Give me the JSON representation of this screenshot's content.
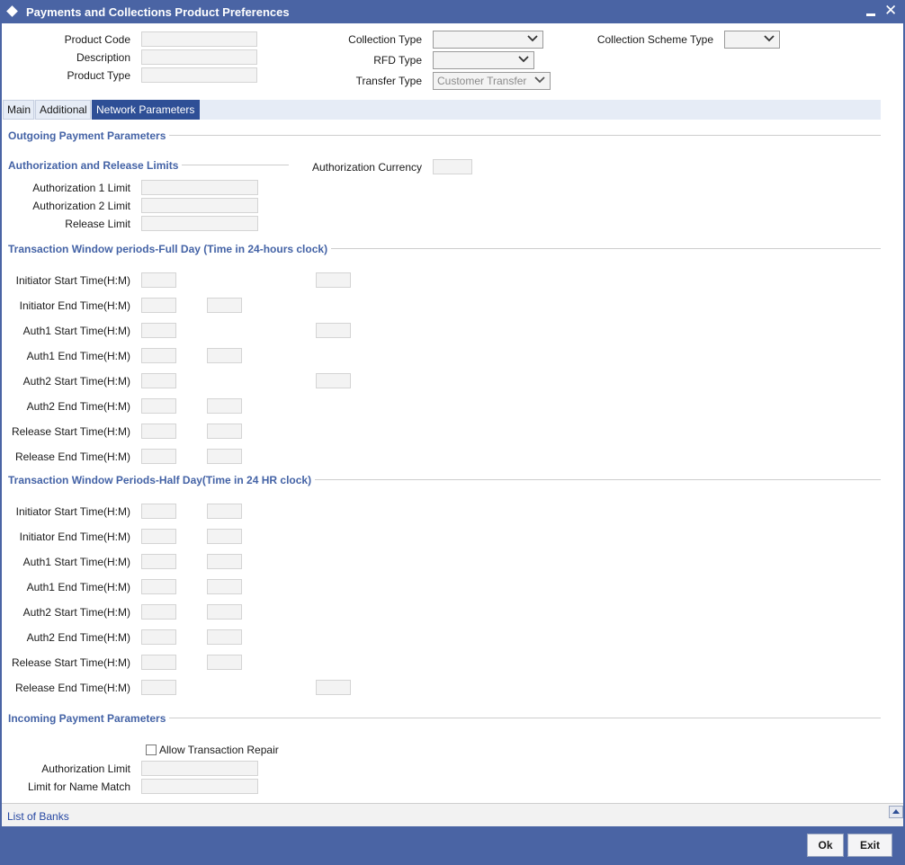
{
  "window": {
    "title": "Payments and Collections Product Preferences"
  },
  "header": {
    "product_code_label": "Product Code",
    "description_label": "Description",
    "product_type_label": "Product Type",
    "collection_type_label": "Collection Type",
    "rfd_type_label": "RFD Type",
    "transfer_type_label": "Transfer Type",
    "transfer_type_value": "Customer Transfer",
    "collection_scheme_type_label": "Collection Scheme Type"
  },
  "tabs": [
    {
      "label": "Main"
    },
    {
      "label": "Additional"
    },
    {
      "label": "Network Parameters"
    }
  ],
  "outgoing": {
    "title": "Outgoing Payment Parameters",
    "auth_limits_title": "Authorization and Release Limits",
    "auth_currency_label": "Authorization Currency",
    "auth1_limit_label": "Authorization 1 Limit",
    "auth2_limit_label": "Authorization 2 Limit",
    "release_limit_label": "Release Limit"
  },
  "full_day": {
    "title": "Transaction Window periods-Full Day (Time in 24-hours clock)",
    "rows": [
      "Initiator Start Time(H:M)",
      "Initiator End Time(H:M)",
      "Auth1 Start Time(H:M)",
      "Auth1 End Time(H:M)",
      "Auth2 Start Time(H:M)",
      "Auth2 End Time(H:M)",
      "Release Start Time(H:M)",
      "Release End Time(H:M)"
    ]
  },
  "half_day": {
    "title": "Transaction Window Periods-Half Day(Time in 24 HR clock)",
    "rows": [
      "Initiator Start Time(H:M)",
      "Initiator End Time(H:M)",
      "Auth1 Start Time(H:M)",
      "Auth1 End Time(H:M)",
      "Auth2 Start Time(H:M)",
      "Auth2 End Time(H:M)",
      "Release Start Time(H:M)",
      "Release End Time(H:M)"
    ]
  },
  "incoming": {
    "title": "Incoming Payment Parameters",
    "allow_repair_label": "Allow Transaction Repair",
    "auth_limit_label": "Authorization Limit",
    "name_match_label": "Limit for Name Match"
  },
  "bottom": {
    "list_of_banks": "List of Banks"
  },
  "footer": {
    "ok_label": "Ok",
    "exit_label": "Exit"
  },
  "colors": {
    "titlebar": "#4a64a4",
    "section_text": "#4463a6",
    "active_tab": "#2e4f96"
  }
}
